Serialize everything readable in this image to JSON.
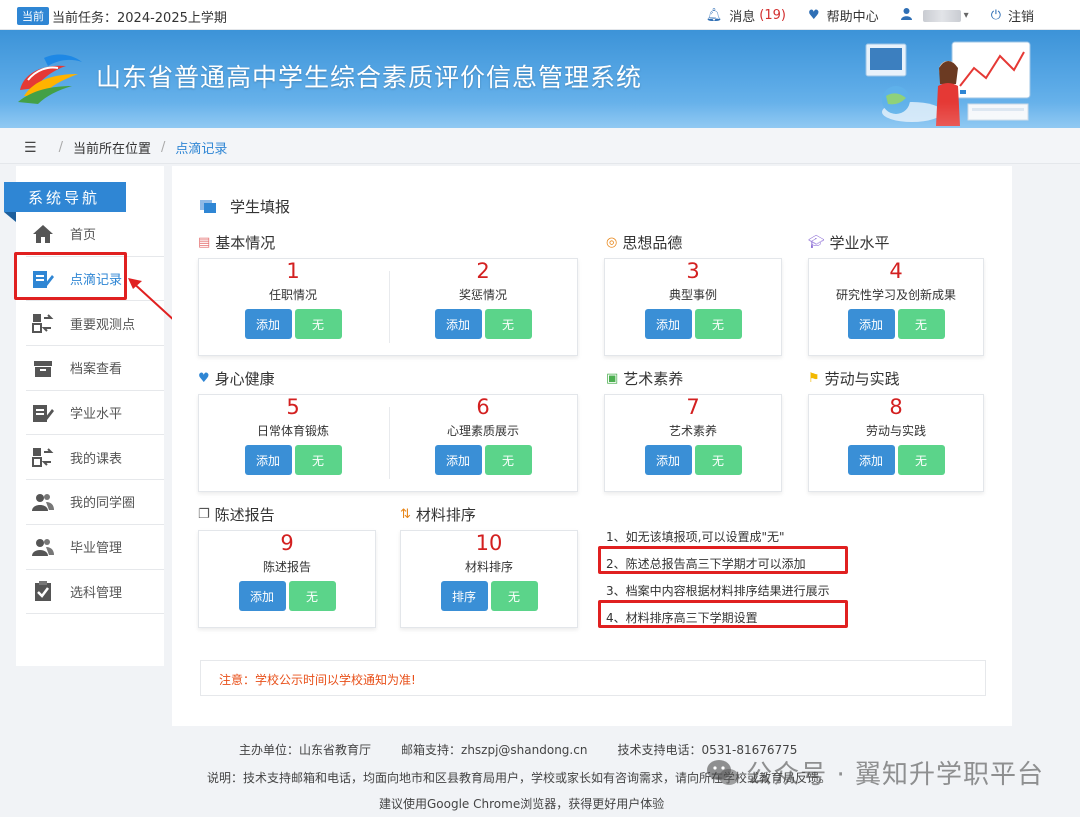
{
  "topbar": {
    "badge": "当前",
    "task": "当前任务：2024-2025上学期",
    "messages_label": "消息",
    "messages_count": "(19)",
    "help_label": "帮助中心",
    "logout_label": "注销"
  },
  "banner": {
    "title": "山东省普通高中学生综合素质评价信息管理系统"
  },
  "breadcrumb": {
    "location_label": "当前所在位置",
    "current": "点滴记录"
  },
  "sidebar": {
    "header": "系统导航",
    "items": [
      {
        "label": "首页",
        "icon": "home-icon"
      },
      {
        "label": "点滴记录",
        "icon": "edit-icon"
      },
      {
        "label": "重要观测点",
        "icon": "swap-icon"
      },
      {
        "label": "档案查看",
        "icon": "archive-icon"
      },
      {
        "label": "学业水平",
        "icon": "edit-icon"
      },
      {
        "label": "我的课表",
        "icon": "swap-icon"
      },
      {
        "label": "我的同学圈",
        "icon": "users-icon"
      },
      {
        "label": "毕业管理",
        "icon": "users-icon"
      },
      {
        "label": "选科管理",
        "icon": "clipboard-icon"
      }
    ]
  },
  "main": {
    "title": "学生填报",
    "sections": {
      "basic": "基本情况",
      "moral": "思想品德",
      "academic": "学业水平",
      "health": "身心健康",
      "art": "艺术素养",
      "labor": "劳动与实践",
      "statement": "陈述报告",
      "sorting": "材料排序"
    },
    "items": [
      {
        "num": "1",
        "label": "任职情况",
        "btn1": "添加",
        "btn2": "无"
      },
      {
        "num": "2",
        "label": "奖惩情况",
        "btn1": "添加",
        "btn2": "无"
      },
      {
        "num": "3",
        "label": "典型事例",
        "btn1": "添加",
        "btn2": "无"
      },
      {
        "num": "4",
        "label": "研究性学习及创新成果",
        "btn1": "添加",
        "btn2": "无"
      },
      {
        "num": "5",
        "label": "日常体育锻炼",
        "btn1": "添加",
        "btn2": "无"
      },
      {
        "num": "6",
        "label": "心理素质展示",
        "btn1": "添加",
        "btn2": "无"
      },
      {
        "num": "7",
        "label": "艺术素养",
        "btn1": "添加",
        "btn2": "无"
      },
      {
        "num": "8",
        "label": "劳动与实践",
        "btn1": "添加",
        "btn2": "无"
      },
      {
        "num": "9",
        "label": "陈述报告",
        "btn1": "添加",
        "btn2": "无"
      },
      {
        "num": "10",
        "label": "材料排序",
        "btn1": "排序",
        "btn2": "无"
      }
    ],
    "notes": [
      "1、如无该填报项,可以设置成\"无\"",
      "2、陈述总报告高三下学期才可以添加",
      "3、档案中内容根据材料排序结果进行展示",
      "4、材料排序高三下学期设置"
    ],
    "notice": "注意：学校公示时间以学校通知为准!"
  },
  "footer": {
    "host": "主办单位：山东省教育厅",
    "email": "邮箱支持：zhszpj@shandong.cn",
    "phone": "技术支持电话：0531-81676775",
    "note": "说明：技术支持邮箱和电话，均面向地市和区县教育局用户，学校或家长如有咨询需求，请向所在学校或教育局反馈。",
    "browser": "建议使用Google Chrome浏览器，获得更好用户体验",
    "watermark": "公众号 · 翼知升学职平台"
  },
  "colors": {
    "primary": "#2f86d4",
    "green_button": "#5bd48a",
    "highlight_red": "#e02020",
    "number_red": "#d32020"
  }
}
